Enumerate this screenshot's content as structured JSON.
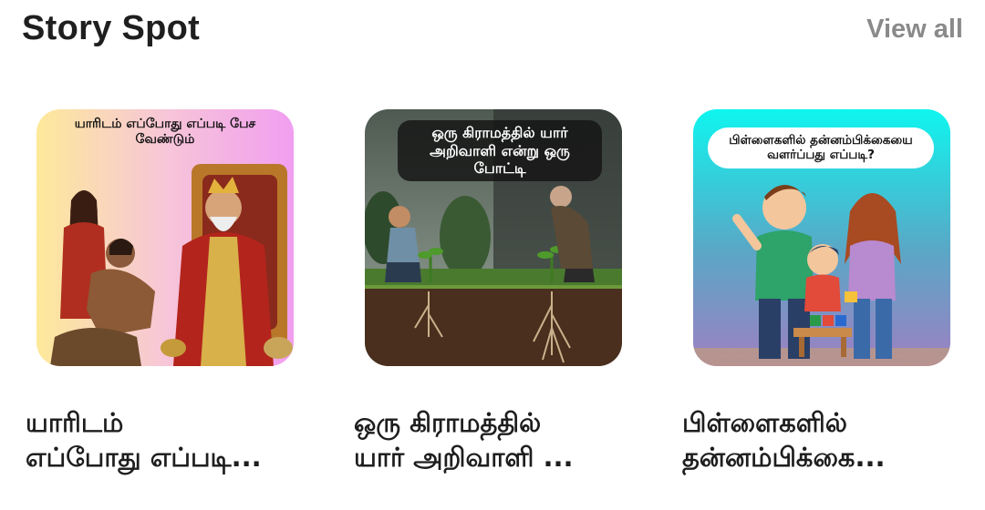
{
  "header": {
    "title": "Story Spot",
    "view_all_label": "View all"
  },
  "cards": [
    {
      "image_caption": "யாரிடம் எப்போது எப்படி பேச வேண்டும்",
      "title": "யாரிடம்\nஎப்போது எப்படி..."
    },
    {
      "image_caption": "ஒரு கிராமத்தில் யார் அறிவாளி என்று ஒரு போட்டி",
      "title": "ஒரு கிராமத்தில்\nயார் அறிவாளி ..."
    },
    {
      "image_caption": "பிள்ளைகளில் தன்னம்பிக்கையை வளர்ப்பது எப்படி?",
      "title": "பிள்ளைகளில்\nதன்னம்பிக்கை..."
    }
  ],
  "colors": {
    "title_text": "#1f1f1f",
    "view_all_text": "#8a8a8a"
  }
}
